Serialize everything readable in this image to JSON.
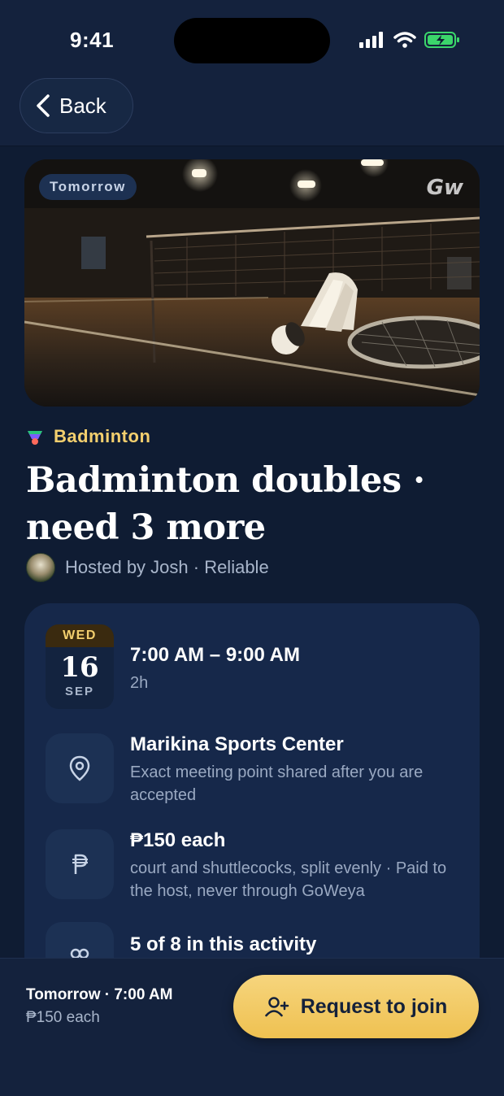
{
  "status_bar": {
    "time": "9:41"
  },
  "header": {
    "back_label": "Back"
  },
  "hero": {
    "badge": "Tomorrow",
    "brand": "Gw"
  },
  "activity": {
    "sport": "Badminton",
    "title": "Badminton doubles · need 3 more",
    "host_text": "Hosted by Josh · Reliable"
  },
  "details": {
    "date": {
      "dow": "WED",
      "day": "16",
      "month": "SEP"
    },
    "time_range": "7:00 AM – 9:00 AM",
    "duration": "2h",
    "location": {
      "name": "Marikina Sports Center",
      "note": "Exact meeting point shared after you are accepted"
    },
    "cost": {
      "amount": "₱150 each",
      "note": "court and shuttlecocks, split evenly · Paid to the host, never through GoWeya"
    },
    "participants": {
      "summary": "5 of 8 in this activity"
    }
  },
  "bottom_bar": {
    "when": "Tomorrow · 7:00 AM",
    "price": "₱150 each",
    "cta_label": "Request to join"
  },
  "colors": {
    "background": "#0f1c33",
    "card": "#16284a",
    "accent": "#f3cf6e",
    "cta": "#f2c85f"
  },
  "icons": [
    "back-chevron-icon",
    "signal-icon",
    "wifi-icon",
    "battery-icon",
    "shuttlecock-icon",
    "location-pin-icon",
    "peso-icon",
    "people-icon",
    "user-plus-icon"
  ]
}
